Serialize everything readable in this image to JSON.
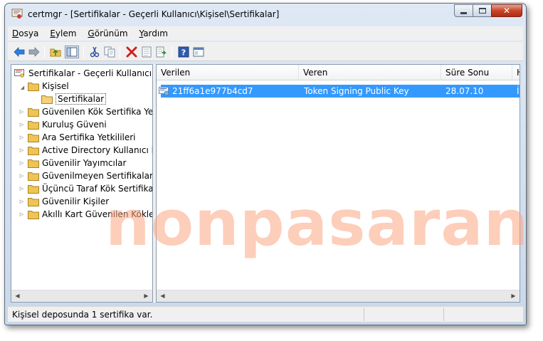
{
  "window": {
    "title": "certmgr - [Sertifikalar - Geçerli Kullanıcı\\Kişisel\\Sertifikalar]"
  },
  "menu": [
    {
      "label": "Dosya",
      "underline": "D",
      "rest": "osya"
    },
    {
      "label": "Eylem",
      "underline": "E",
      "rest": "ylem"
    },
    {
      "label": "Görünüm",
      "underline": "G",
      "rest": "örünüm"
    },
    {
      "label": "Yardım",
      "underline": "Y",
      "rest": "ardım"
    }
  ],
  "toolbar_icons": [
    "back-arrow-icon",
    "forward-arrow-icon",
    "up-folder-icon",
    "show-hide-tree-icon",
    "cut-icon",
    "copy-icon",
    "delete-icon",
    "properties-icon",
    "export-icon",
    "help-icon",
    "console-icon"
  ],
  "tree": {
    "root": "Sertifikalar - Geçerli Kullanıcı",
    "personal": "Kişisel",
    "certificates": "Sertifikalar",
    "items": [
      "Güvenilen Kök Sertifika Yetkil",
      "Kuruluş Güveni",
      "Ara Sertifika Yetkilileri",
      "Active Directory Kullanıcı Nes",
      "Güvenilir Yayımcılar",
      "Güvenilmeyen Sertifikalar",
      "Üçüncü Taraf Kök Sertifika Ye",
      "Güvenilir Kişiler",
      "Akıllı Kart Güvenilen Kökleri"
    ]
  },
  "list": {
    "columns": [
      "Verilen",
      "Veren",
      "Süre Sonu",
      "H"
    ],
    "rows": [
      {
        "issued_to": "21ff6a1e977b4cd7",
        "issued_by": "Token Signing Public Key",
        "expires": "28.07.10",
        "purpose": "İ"
      }
    ]
  },
  "status": {
    "text": "Kişisel deposunda 1 sertifika var."
  },
  "watermark": "nonpasaran",
  "colors": {
    "selection": "#3399ff",
    "watermark": "#fca582",
    "folder": "#f0c453"
  }
}
